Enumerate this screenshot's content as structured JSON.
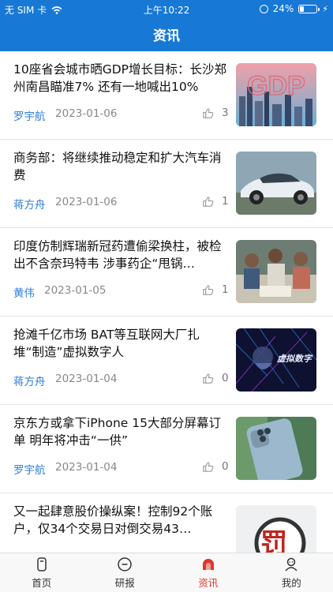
{
  "status": {
    "carrier": "无 SIM 卡",
    "time": "上午10:22",
    "battery_percent": "24%",
    "battery_level": 0.24
  },
  "header": {
    "title": "资讯"
  },
  "articles": [
    {
      "title": "10座省会城市晒GDP增长目标：长沙郑州南昌瞄准7% 还有一地喊出10%",
      "author": "罗宇航",
      "date": "2023-01-06",
      "likes": "3",
      "thumb_text": "GDP"
    },
    {
      "title": "商务部：将继续推动稳定和扩大汽车消费",
      "author": "蒋方舟",
      "date": "2023-01-06",
      "likes": "1"
    },
    {
      "title": "印度仿制辉瑞新冠药遭偷梁换柱，被检出不含奈玛特韦 涉事药企“甩锅…",
      "author": "黄伟",
      "date": "2023-01-05",
      "likes": "1"
    },
    {
      "title": "抢滩千亿市场 BAT等互联网大厂扎堆“制造”虚拟数字人",
      "author": "蒋方舟",
      "date": "2023-01-04",
      "likes": "0",
      "thumb_text": "虚拟数字"
    },
    {
      "title": "京东方或拿下iPhone 15大部分屏幕订单 明年将冲击“一供”",
      "author": "罗宇航",
      "date": "2023-01-04",
      "likes": "0"
    },
    {
      "title": "又一起肆意股价操纵案！控制92个账户，仅34个交易日对倒交易43…",
      "author": "",
      "date": "",
      "likes": "",
      "thumb_text": "罚"
    }
  ],
  "tabs": [
    {
      "label": "首页",
      "icon": "home-icon"
    },
    {
      "label": "研报",
      "icon": "report-icon"
    },
    {
      "label": "资讯",
      "icon": "news-icon",
      "active": true
    },
    {
      "label": "我的",
      "icon": "profile-icon"
    }
  ],
  "colors": {
    "primary": "#1778d6",
    "accent": "#e0362c",
    "author": "#2f7fd8"
  }
}
